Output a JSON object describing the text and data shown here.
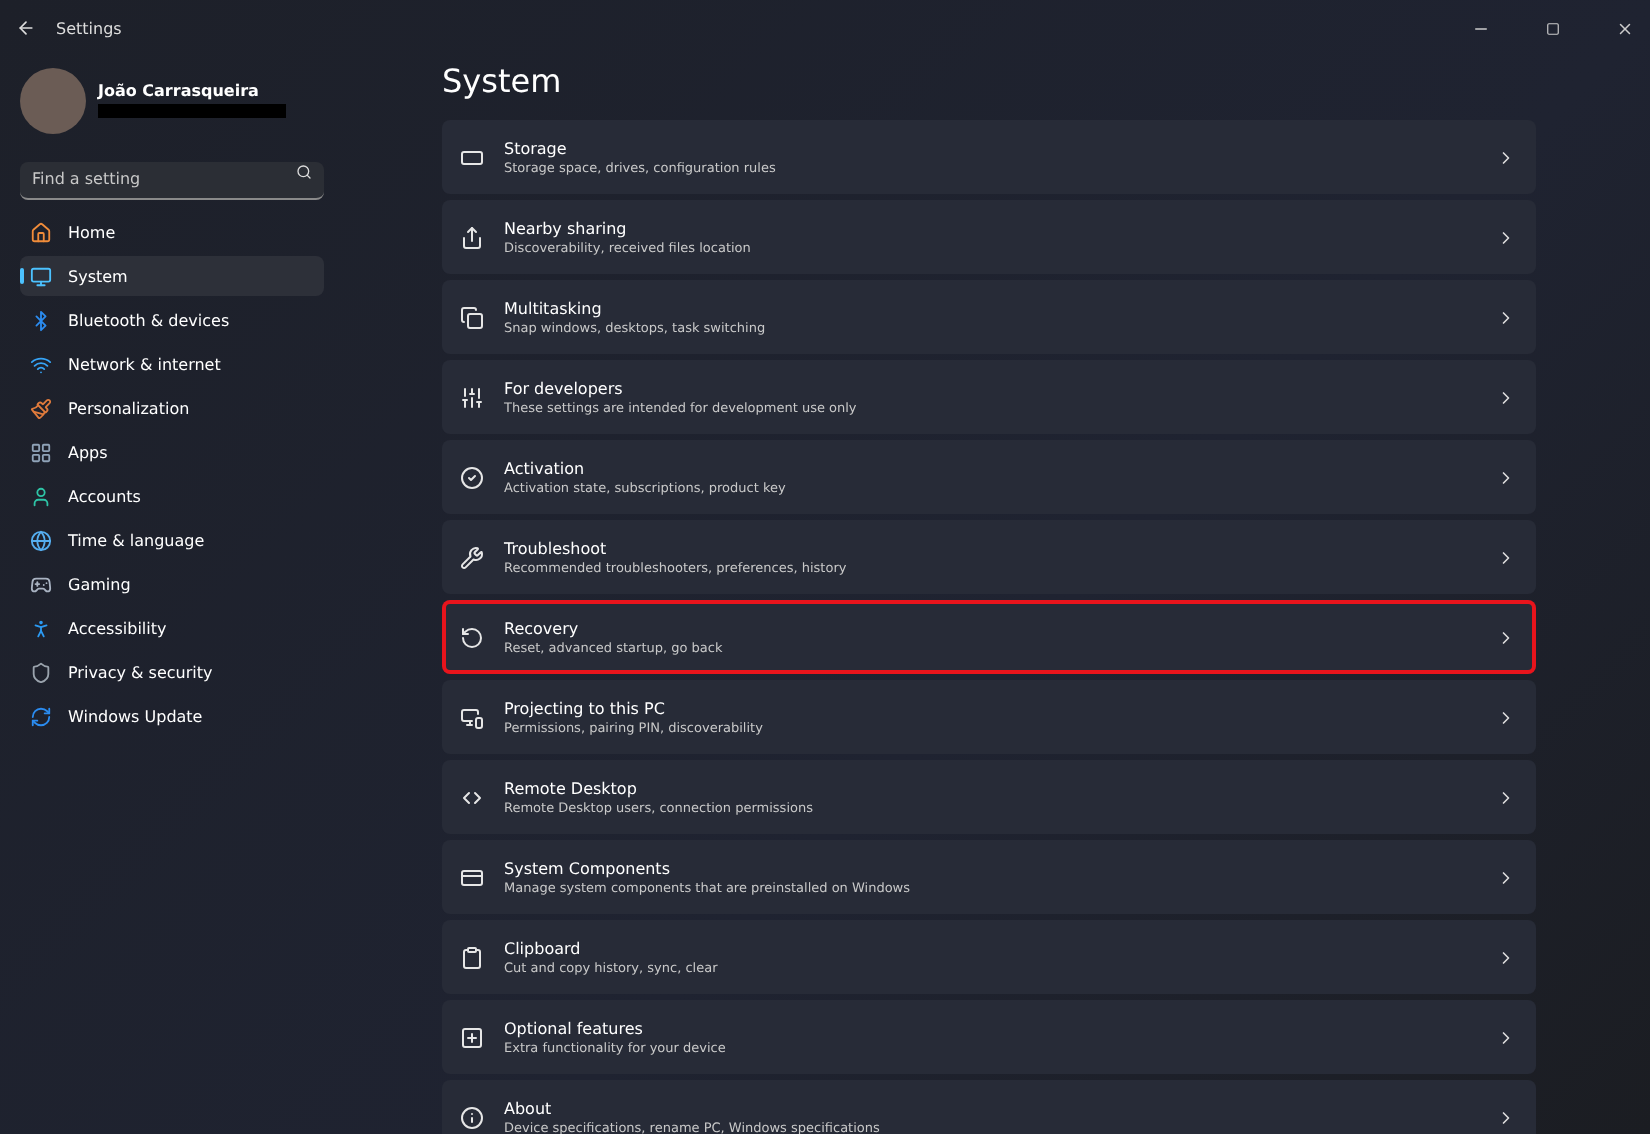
{
  "window": {
    "title": "Settings"
  },
  "user": {
    "name": "João Carrasqueira",
    "email_redacted": true
  },
  "search": {
    "placeholder": "Find a setting"
  },
  "sidebar": {
    "items": [
      {
        "label": "Home",
        "selected": false
      },
      {
        "label": "System",
        "selected": true
      },
      {
        "label": "Bluetooth & devices",
        "selected": false
      },
      {
        "label": "Network & internet",
        "selected": false
      },
      {
        "label": "Personalization",
        "selected": false
      },
      {
        "label": "Apps",
        "selected": false
      },
      {
        "label": "Accounts",
        "selected": false
      },
      {
        "label": "Time & language",
        "selected": false
      },
      {
        "label": "Gaming",
        "selected": false
      },
      {
        "label": "Accessibility",
        "selected": false
      },
      {
        "label": "Privacy & security",
        "selected": false
      },
      {
        "label": "Windows Update",
        "selected": false
      }
    ]
  },
  "page": {
    "title": "System",
    "items": [
      {
        "title": "Storage",
        "description": "Storage space, drives, configuration rules",
        "highlighted": false
      },
      {
        "title": "Nearby sharing",
        "description": "Discoverability, received files location",
        "highlighted": false
      },
      {
        "title": "Multitasking",
        "description": "Snap windows, desktops, task switching",
        "highlighted": false
      },
      {
        "title": "For developers",
        "description": "These settings are intended for development use only",
        "highlighted": false
      },
      {
        "title": "Activation",
        "description": "Activation state, subscriptions, product key",
        "highlighted": false
      },
      {
        "title": "Troubleshoot",
        "description": "Recommended troubleshooters, preferences, history",
        "highlighted": false
      },
      {
        "title": "Recovery",
        "description": "Reset, advanced startup, go back",
        "highlighted": true
      },
      {
        "title": "Projecting to this PC",
        "description": "Permissions, pairing PIN, discoverability",
        "highlighted": false
      },
      {
        "title": "Remote Desktop",
        "description": "Remote Desktop users, connection permissions",
        "highlighted": false
      },
      {
        "title": "System Components",
        "description": "Manage system components that are preinstalled on Windows",
        "highlighted": false
      },
      {
        "title": "Clipboard",
        "description": "Cut and copy history, sync, clear",
        "highlighted": false
      },
      {
        "title": "Optional features",
        "description": "Extra functionality for your device",
        "highlighted": false
      },
      {
        "title": "About",
        "description": "Device specifications, rename PC, Windows specifications",
        "highlighted": false
      }
    ]
  }
}
